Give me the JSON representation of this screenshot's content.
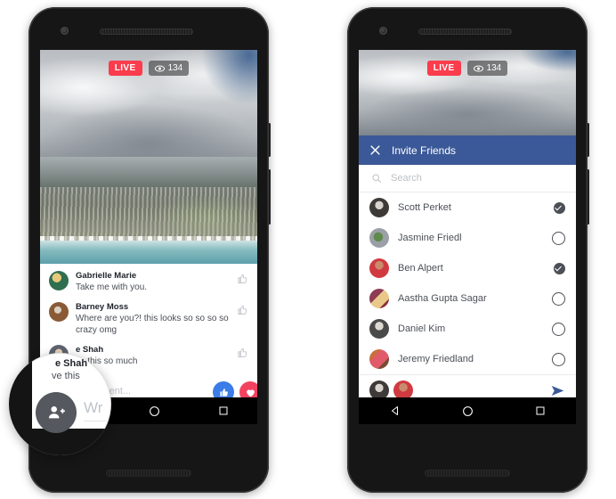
{
  "scene": {
    "description": "Two Android phones showing Facebook Live: left phone with live video and comments, right phone with the Invite Friends sheet open"
  },
  "live_overlay": {
    "live_label": "LIVE",
    "viewer_count": "134",
    "eye_icon": "eye-icon",
    "live_color": "#fa3c4c",
    "pill_color": "rgba(60,60,60,0.62)"
  },
  "left_phone": {
    "comments": [
      {
        "name": "Gabrielle Marie",
        "text": "Take me with you.",
        "like_icon": "thumbs-up-outline-icon"
      },
      {
        "name": "Barney Moss",
        "text": "Where are you?! this looks so so so so crazy omg",
        "like_icon": "thumbs-up-outline-icon"
      },
      {
        "name": "e Shah",
        "text": "ve this so much",
        "like_icon": "thumbs-up-outline-icon"
      }
    ],
    "composer": {
      "placeholder": "Write a comment...",
      "like_button_icon": "thumbs-up-filled-icon",
      "heart_button_icon": "heart-filled-icon",
      "like_color": "#3b7ce8",
      "heart_color": "#f3425f"
    },
    "navbar": {
      "home_icon": "home-circle-icon",
      "recents_icon": "recents-square-icon"
    }
  },
  "magnifier": {
    "partial_name": "e Shah",
    "partial_text": "ve this",
    "write_text": "Wr",
    "invite_button_icon": "add-person-icon",
    "button_color": "#55595f"
  },
  "right_phone": {
    "invite_panel": {
      "close_icon": "close-x-icon",
      "title": "Invite Friends",
      "header_color": "#3b5998",
      "search": {
        "icon": "search-icon",
        "placeholder": "Search"
      },
      "friends": [
        {
          "name": "Scott Perket",
          "selected": true,
          "avatar": "avatar-scott"
        },
        {
          "name": "Jasmine Friedl",
          "selected": false,
          "avatar": "avatar-jasmine"
        },
        {
          "name": "Ben Alpert",
          "selected": true,
          "avatar": "avatar-ben"
        },
        {
          "name": "Aastha Gupta Sagar",
          "selected": false,
          "avatar": "avatar-aastha"
        },
        {
          "name": "Daniel Kim",
          "selected": false,
          "avatar": "avatar-daniel"
        },
        {
          "name": "Jeremy Friedland",
          "selected": false,
          "avatar": "avatar-jeremy"
        }
      ],
      "send_bar": {
        "selected_avatars": [
          "avatar-scott",
          "avatar-ben"
        ],
        "send_icon": "send-arrow-icon",
        "send_color": "#3b5998"
      }
    },
    "navbar": {
      "back_icon": "back-triangle-icon",
      "home_icon": "home-circle-icon",
      "recents_icon": "recents-square-icon"
    }
  }
}
